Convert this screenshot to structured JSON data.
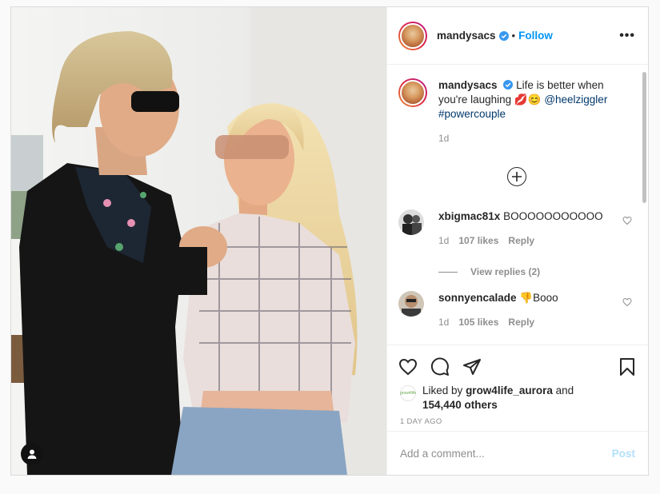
{
  "post": {
    "username": "mandysacs",
    "follow_label": "Follow",
    "separator": "•",
    "more_label": "•••",
    "caption": {
      "username": "mandysacs",
      "text": "Life is better when you're laughing",
      "emoji": "💋😊",
      "mention": "@heelziggler",
      "hashtag": "#powercouple",
      "time": "1d"
    },
    "comments": [
      {
        "username": "xbigmac81x",
        "text": "BOOOOOOOOOOO",
        "time": "1d",
        "likes": "107 likes",
        "reply_label": "Reply"
      },
      {
        "username": "sonnyencalade",
        "text": "👎Booo",
        "time": "1d",
        "likes": "105 likes",
        "reply_label": "Reply"
      }
    ],
    "view_replies": "View replies (2)",
    "liked_by_prefix": "Liked by",
    "liked_by_user": "grow4life_aurora",
    "liked_by_and": "and",
    "liked_by_others": "154,440 others",
    "like_avatar_text": "grow4life",
    "post_time": "1 DAY AGO",
    "add_comment_placeholder": "Add a comment...",
    "post_label": "Post",
    "icons": [
      "heart-icon",
      "comment-icon",
      "share-icon",
      "bookmark-icon",
      "plus-circle-icon",
      "verified-badge-icon",
      "user-tag-icon"
    ]
  },
  "colors": {
    "link_blue": "#0095f6",
    "post_disabled": "#b2dffc",
    "text": "#262626",
    "muted": "#8e8e8e"
  }
}
